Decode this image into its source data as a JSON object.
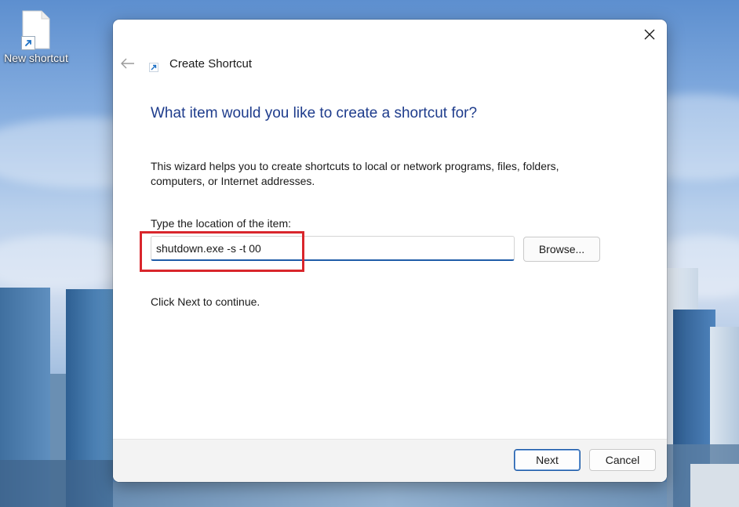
{
  "desktop": {
    "shortcut_label": "New shortcut"
  },
  "dialog": {
    "title": "Create Shortcut",
    "heading": "What item would you like to create a shortcut for?",
    "description": "This wizard helps you to create shortcuts to local or network programs, files, folders, computers, or Internet addresses.",
    "location_label": "Type the location of the item:",
    "location_value": "shutdown.exe -s -t 00",
    "browse_label": "Browse...",
    "continue_text": "Click Next to continue.",
    "next_label": "Next",
    "cancel_label": "Cancel"
  },
  "colors": {
    "heading": "#1e3c8c",
    "accent": "#1f5ca8",
    "highlight": "#d9262c"
  },
  "icons": {
    "close": "close-icon",
    "back": "back-arrow-icon",
    "shortcut": "shortcut-arrow-icon",
    "file": "file-icon"
  }
}
